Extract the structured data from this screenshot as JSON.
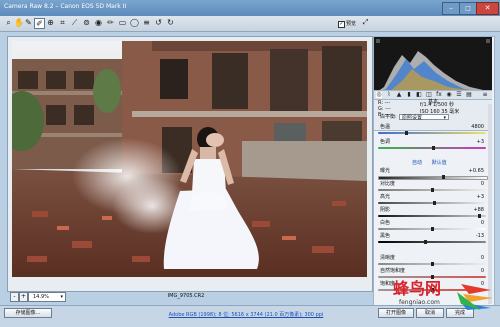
{
  "window": {
    "title": "Camera Raw 8.2 – Canon EOS 5D Mark II",
    "controls": [
      "–",
      "□",
      "✕"
    ]
  },
  "toolbar": {
    "tools": [
      "zoom-icon",
      "hand-icon",
      "white-balance-icon",
      "color-sampler-icon",
      "target-adjust-icon",
      "crop-icon",
      "straighten-icon",
      "spot-removal-icon",
      "redeye-icon",
      "adjust-brush-icon",
      "graduated-filter-icon",
      "radial-filter-icon",
      "menu-icon",
      "rotate-ccw-icon",
      "rotate-cw-icon"
    ],
    "preview_checked": "✓",
    "preview_label": "预览"
  },
  "canvas": {
    "filename": "IMG_9705.CR2",
    "zoom_value": "14.9%",
    "zoom_out": "-",
    "zoom_in": "+"
  },
  "info": {
    "rgb_r": "R: ---",
    "rgb_g": "G: ---",
    "rgb_b": "B: ---",
    "exposure": "f/1.4   1/500 秒",
    "iso": "ISO 160   35 毫米"
  },
  "panel": {
    "section": "基本",
    "wb_label": "白平衡:",
    "wb_value": "原照设置",
    "temp_label": "色温",
    "temp_value": "4800",
    "tint_label": "色调",
    "tint_value": "+3",
    "auto": "自动",
    "default": "默认值",
    "exposure_label": "曝光",
    "exposure_value": "+0.65",
    "contrast_label": "对比度",
    "contrast_value": "0",
    "highlights_label": "高光",
    "highlights_value": "+3",
    "shadows_label": "阴影",
    "shadows_value": "+88",
    "whites_label": "白色",
    "whites_value": "0",
    "blacks_label": "黑色",
    "blacks_value": "-13",
    "clarity_label": "清晰度",
    "clarity_value": "0",
    "vibrance_label": "自然饱和度",
    "vibrance_value": "0",
    "saturation_label": "饱和度",
    "saturation_value": "0"
  },
  "bottom": {
    "save_label": "存储图像...",
    "workflow_link": "Adobe RGB (1998); 8 位; 5616 x 3744 (21.0 百万像素); 300 ppi",
    "open_label": "打开图像",
    "cancel_label": "取消",
    "done_label": "完成"
  },
  "watermark": {
    "brand_cn": "蜂鸟网",
    "brand_url": "fengniao.com"
  },
  "colors": {
    "title_bar": "#6a97c6",
    "link": "#1d4fb5",
    "accent_red": "#d8232a"
  }
}
